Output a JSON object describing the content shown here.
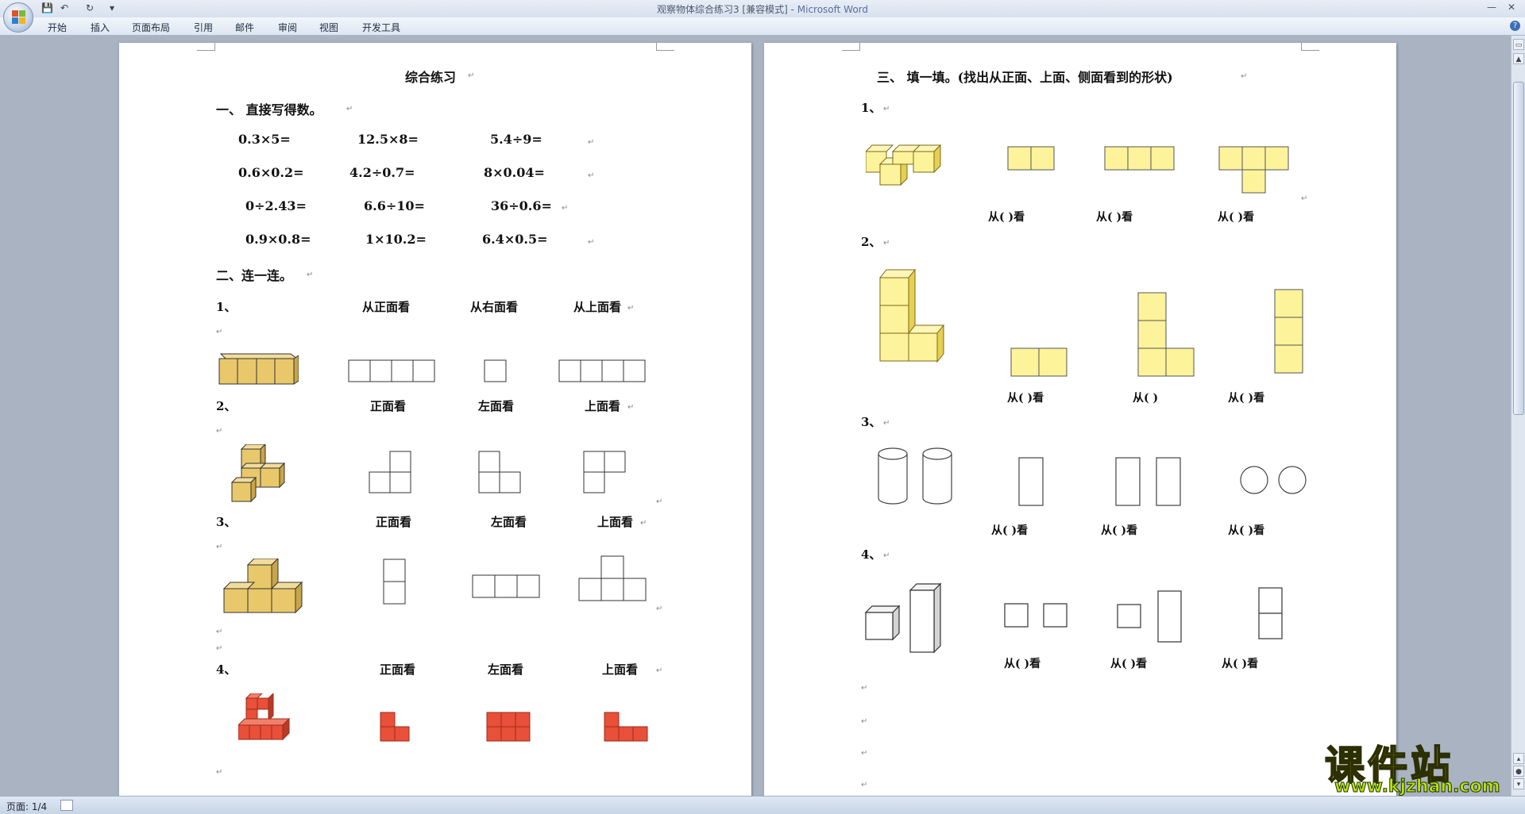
{
  "window": {
    "title_doc": "观察物体综合练习3 [兼容模式]",
    "title_sep": " - ",
    "title_app": "Microsoft Word"
  },
  "ribbon_tabs": [
    "开始",
    "插入",
    "页面布局",
    "引用",
    "邮件",
    "审阅",
    "视图",
    "开发工具"
  ],
  "left_page": {
    "title": "综合练习",
    "s1_heading": "一、  直接写得数。",
    "calc_rows": [
      [
        "0.3×5=",
        "12.5×8=",
        "5.4÷9="
      ],
      [
        "0.6×0.2=",
        "4.2÷0.7=",
        "8×0.04="
      ],
      [
        "0÷2.43=",
        "6.6÷10=",
        "36÷0.6="
      ],
      [
        "0.9×0.8=",
        "1×10.2=",
        "6.4×0.5="
      ]
    ],
    "s2_heading": "二、连一连。",
    "q1_num": "1、",
    "q1_labels": [
      "从正面看",
      "从右面看",
      "从上面看"
    ],
    "q2_num": "2、",
    "q2_labels": [
      "正面看",
      "左面看",
      "上面看"
    ],
    "q3_num": "3、",
    "q3_labels": [
      "正面看",
      "左面看",
      "上面看"
    ],
    "q4_num": "4、",
    "q4_labels": [
      "正面看",
      "左面看",
      "上面看"
    ]
  },
  "right_page": {
    "s3_heading": "三、  填一填。(找出从正面、上面、侧面看到的形状)",
    "q1_num": "1、",
    "q2_num": "2、",
    "q3_num": "3、",
    "q4_num": "4、",
    "look_full": "从(    )看",
    "look_open": "从(    )",
    "q1_labels": [
      "从(    )看",
      "从(    )看",
      "从(    )看"
    ],
    "q2_labels": [
      "从(    )看",
      "从(    )",
      "从(    )看"
    ],
    "q3_labels": [
      "从(    )看",
      "从(    )看",
      "从(    )看"
    ],
    "q4_labels": [
      "从(    )看",
      "从(    )看",
      "从(    )看"
    ]
  },
  "status": {
    "page": "页面: 1/4"
  },
  "watermark": {
    "text": "课件站",
    "url": "www.kjzhan.com"
  },
  "colors": {
    "yellow_cube": "#e8c86a",
    "pale_yellow": "#fdf39a",
    "red_cube": "#e8503a"
  }
}
